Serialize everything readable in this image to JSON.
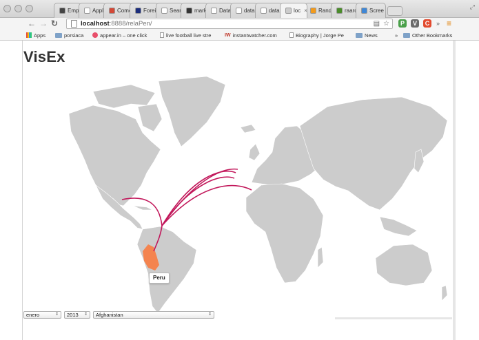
{
  "browser": {
    "tabs": [
      {
        "label": "Emple",
        "icon_color": "#444444"
      },
      {
        "label": "Applic",
        "icon_color": "#ffffff"
      },
      {
        "label": "Come",
        "icon_color": "#d34836"
      },
      {
        "label": "Foreig",
        "icon_color": "#1b2d7d"
      },
      {
        "label": "Searc",
        "icon_color": "#ffffff"
      },
      {
        "label": "marke",
        "icon_color": "#333333"
      },
      {
        "label": "DataM",
        "icon_color": "#ffffff"
      },
      {
        "label": "datam",
        "icon_color": "#ffffff"
      },
      {
        "label": "datam",
        "icon_color": "#ffffff"
      },
      {
        "label": "loc",
        "icon_color": "#cccccc",
        "active": true
      },
      {
        "label": "Rando",
        "icon_color": "#f29a1b"
      },
      {
        "label": "raarc",
        "icon_color": "#4a8c2a"
      },
      {
        "label": "Scree",
        "icon_color": "#3f87d6"
      }
    ],
    "tab_close_glyph": "×",
    "url_host": "localhost",
    "url_path": ":8888/relaPen/",
    "bookmarks": [
      {
        "label": "Apps",
        "icon": "apps-icon"
      },
      {
        "label": "porsiaca",
        "icon": "folder-icon"
      },
      {
        "label": "appear.in – one click",
        "icon": "appear-icon"
      },
      {
        "label": "live football live stre",
        "icon": "page-icon"
      },
      {
        "label": "instantwatcher.com",
        "icon": "iw-icon"
      },
      {
        "label": "Biography | Jorge Pe",
        "icon": "page-icon"
      },
      {
        "label": "News",
        "icon": "folder-icon"
      },
      {
        "label": "»",
        "icon": ""
      },
      {
        "label": "Other Bookmarks",
        "icon": "folder-icon"
      }
    ]
  },
  "app": {
    "title": "VisEx",
    "tooltip": "Peru",
    "controls": {
      "month": "enero",
      "year": "2013",
      "country": "Afghanistan"
    }
  },
  "colors": {
    "land": "#cccccc",
    "highlight": "#f4844f",
    "flow_lines": "#c2185b",
    "page_bg": "#ffffff"
  }
}
